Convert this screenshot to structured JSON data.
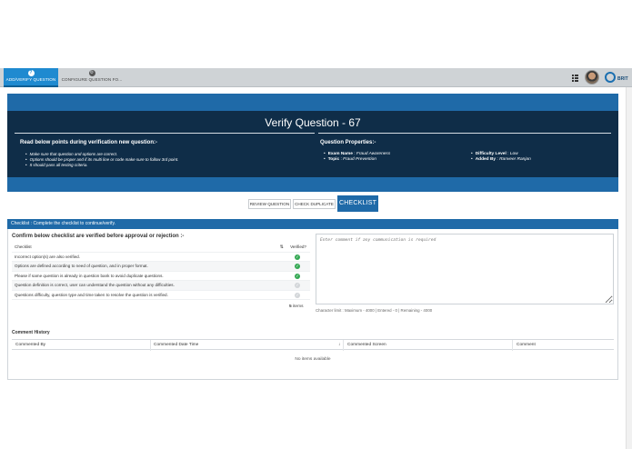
{
  "tabs": [
    {
      "label": "ADD/VERIFY QUESTION",
      "icon": "question-icon",
      "active": true
    },
    {
      "label": "CONFIGURE QUESTION FO...",
      "icon": "gear-icon",
      "active": false
    }
  ],
  "brand": {
    "logo_text": "BRIT"
  },
  "header": {
    "title": "Verify Question - 67"
  },
  "points": {
    "heading": "Read below points during verification new question:-",
    "items": [
      "Make sure that question and options are correct.",
      "Options should be proper and if its multi line or code make sure to follow 3rd point.",
      "It should pass all testing criteria."
    ]
  },
  "properties": {
    "heading": "Question Properties:-",
    "exam_name_label": "Exam Name",
    "exam_name_value": "Fraud Awareness",
    "topic_label": "Topic",
    "topic_value": "Fraud Prevention",
    "difficulty_label": "Difficulty Level",
    "difficulty_value": "Low",
    "added_by_label": "Added By",
    "added_by_value": "Ranveer Ranjan"
  },
  "actions": {
    "review": "REVIEW QUESTION",
    "duplicate": "CHECK DUPLICATE",
    "checklist": "CHECKLIST"
  },
  "checklist": {
    "bar": "Checklist : Complete the checklist to continue/verify.",
    "confirm": "Confirm below checklist are verified before approval or rejection :-",
    "col_checklist": "Checklist",
    "col_verified": "Verified?",
    "rows": [
      {
        "label": "Incorrect option(s) are also verified.",
        "verified": true
      },
      {
        "label": "Options are defined according to need of question, and in proper format.",
        "verified": true
      },
      {
        "label": "Please if same question is already in question bank to avoid duplicate questions.",
        "verified": true
      },
      {
        "label": "Question definition is correct, user can understand the question without any difficulties.",
        "verified": false
      },
      {
        "label": "Questions difficulty, question type and time taken to resolve the question is verified.",
        "verified": false
      }
    ],
    "count": "5",
    "count_label": "items"
  },
  "comment": {
    "placeholder": "Enter comment if any communication is required",
    "char_limit": "Character limit : Maximum - 4000 | Entered - 0 | Remaining - 4000"
  },
  "history": {
    "title": "Comment History",
    "columns": [
      "Commented By",
      "Commented Date Time",
      "Commented Screen",
      "Comment"
    ],
    "empty": "No items available"
  }
}
